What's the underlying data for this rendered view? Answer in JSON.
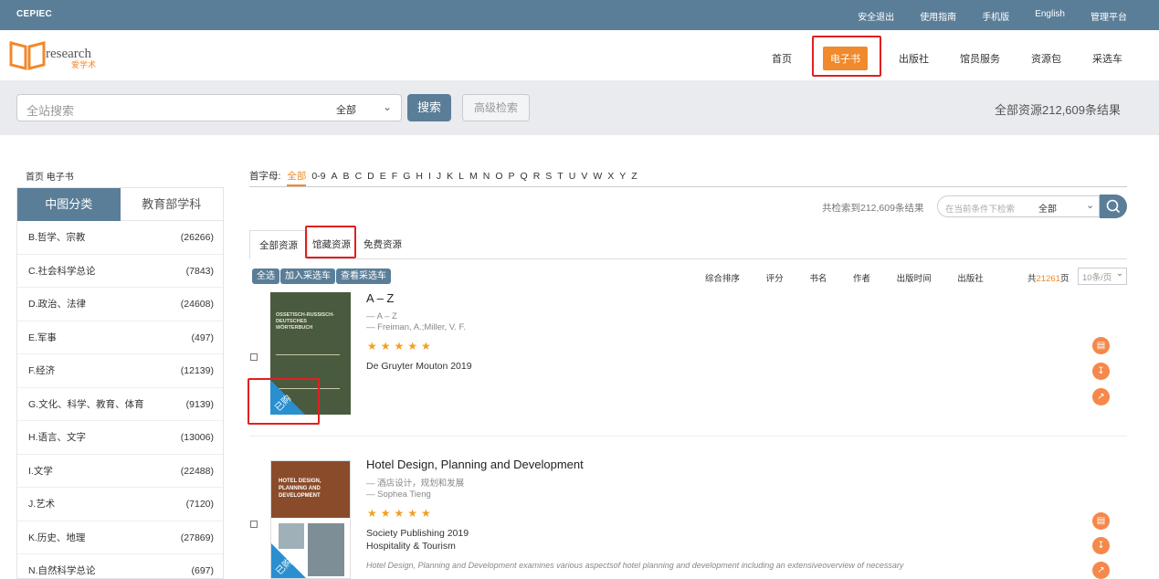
{
  "topbar": {
    "brand": "CEPIEC",
    "links": [
      "安全退出",
      "使用指南",
      "手机版",
      "English",
      "管理平台"
    ]
  },
  "logo": {
    "text": "research",
    "subtext": "爱学术"
  },
  "nav": {
    "items": [
      "首页",
      "电子书",
      "出版社",
      "馆员服务",
      "资源包",
      "采选车"
    ],
    "active": "电子书"
  },
  "search": {
    "placeholder": "全站搜索",
    "scope": "全部",
    "button": "搜索",
    "advanced": "高级检索",
    "total": "全部资源212,609条结果"
  },
  "breadcrumb": "首页 电子书",
  "sidebar": {
    "tabs": [
      "中图分类",
      "教育部学科"
    ],
    "categories": [
      {
        "name": "B.哲学、宗教",
        "count": "(26266)"
      },
      {
        "name": "C.社会科学总论",
        "count": "(7843)"
      },
      {
        "name": "D.政治、法律",
        "count": "(24608)"
      },
      {
        "name": "E.军事",
        "count": "(497)"
      },
      {
        "name": "F.经济",
        "count": "(12139)"
      },
      {
        "name": "G.文化、科学、教育、体育",
        "count": "(9139)"
      },
      {
        "name": "H.语言、文字",
        "count": "(13006)"
      },
      {
        "name": "I.文学",
        "count": "(22488)"
      },
      {
        "name": "J.艺术",
        "count": "(7120)"
      },
      {
        "name": "K.历史、地理",
        "count": "(27869)"
      },
      {
        "name": "N.自然科学总论",
        "count": "(697)"
      }
    ]
  },
  "alpha": {
    "label": "首字母:",
    "letters": [
      "全部",
      "0-9",
      "A",
      "B",
      "C",
      "D",
      "E",
      "F",
      "G",
      "H",
      "I",
      "J",
      "K",
      "L",
      "M",
      "N",
      "O",
      "P",
      "Q",
      "R",
      "S",
      "T",
      "U",
      "V",
      "W",
      "X",
      "Y",
      "Z"
    ]
  },
  "results": {
    "found": "共检索到212,609条结果",
    "filter_placeholder": "在当前条件下检索",
    "filter_scope": "全部"
  },
  "restabs": [
    "全部资源",
    "馆藏资源",
    "免费资源"
  ],
  "tools": [
    "全选",
    "加入采选车",
    "查看采选车"
  ],
  "sorts": [
    "综合排序",
    "评分",
    "书名",
    "作者",
    "出版时间",
    "出版社"
  ],
  "paging": {
    "prefix": "共",
    "pages": "21261",
    "suffix": "页",
    "perpage": "10条/页"
  },
  "colors": {
    "primary": "#5a7e98",
    "accent": "#f08a2c",
    "star": "#f0a020",
    "highlight": "#e02020"
  },
  "books": [
    {
      "title": "A – Z",
      "subtitle": "— A – Z",
      "authors": "— Freiman, A.;Miller, V. F.",
      "stars": "★★★★★",
      "publisher": "De Gruyter Mouton 2019",
      "category": "",
      "description": "",
      "cover_title": "OSSETISCH-RUSSISCH-DEUTSCHES WÖRTERBUCH",
      "badge": "已购"
    },
    {
      "title": "Hotel Design, Planning and Development",
      "subtitle": "— 酒店设计，规划和发展",
      "authors": "— Sophea Tieng",
      "stars": "★★★★★",
      "publisher": "Society Publishing 2019",
      "category": "Hospitality & Tourism",
      "description": "Hotel Design, Planning and Development examines various aspectsof hotel planning and development including an extensiveoverview of necessary",
      "cover_title": "HOTEL DESIGN, PLANNING AND DEVELOPMENT",
      "badge": "已购"
    }
  ]
}
